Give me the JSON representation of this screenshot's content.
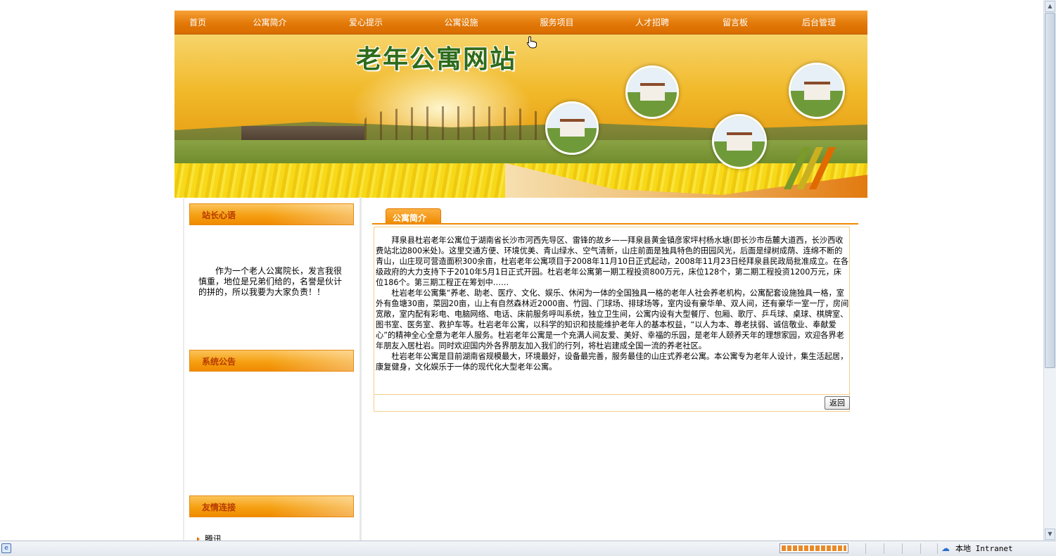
{
  "site": {
    "nav": [
      "首页",
      "公寓简介",
      "爱心提示",
      "公寓设施",
      "服务项目",
      "人才招聘",
      "留言板",
      "后台管理"
    ],
    "banner_title": "老年公寓网站"
  },
  "sidebar": {
    "director_header": "站长心语",
    "director_note": "作为一个老人公寓院长，发言我很慎重，地位是兄弟们给的，名誉是伙计的拼的，所以我要为大家负责！！",
    "announcement_header": "系统公告",
    "links_header": "友情连接",
    "links": [
      "腾讯"
    ]
  },
  "content": {
    "tab_label": "公寓简介",
    "paragraphs": [
      "拜泉县杜岩老年公寓位于湖南省长沙市河西先导区、雷锋的故乡——拜泉县黄金镇彦家坪村杨水塘(即长沙市岳麓大道西，长沙西收费站北边800米处)。这里交通方便、环境优美、青山绿水、空气清新，山庄前面是独具特色的田园风光，后面是绿树成荫、连绵不断的青山，山庄现可营造面积300余亩，杜岩老年公寓项目于2008年11月10日正式起动，2008年11月23日经拜泉县民政局批准成立。在各级政府的大力支持下于2010年5月1日正式开园。杜岩老年公寓第一期工程投资800万元，床位128个，第二期工程投资1200万元，床位186个。第三期工程正在筹划中……",
      "杜岩老年公寓集“养老、助老、医疗、文化、娱乐、休闲为一体的全国独具一格的老年人社会养老机构，公寓配套设施独具一格，室外有鱼塘30亩，菜园20亩，山上有自然森林近2000亩、竹园、门球场、排球场等，室内设有豪华单、双人间，还有豪华一室一厅，房间宽敞，室内配有彩电、电脑网络、电话、床前服务呼叫系统，独立卫生间，公寓内设有大型餐厅、包厢、歌厅、乒乓球、桌球、棋牌室、图书室、医务室、救护车等。杜岩老年公寓，以科学的知识和技能维护老年人的基本权益，“以人为本、尊老扶弱、诚信敬业、奉献爱心”的精神全心全意为老年人服务。杜岩老年公寓是一个充满人间友爱、美好、幸福的乐园，是老年人颐养天年的理想家园，欢迎各界老年朋友入居杜岩。同时欢迎国内外各界朋友加入我们的行列，将杜岩建成全国一流的养老社区。",
      "杜岩老年公寓是目前湖南省规模最大，环境最好，设备最完善，服务最佳的山庄式养老公寓。本公寓专为老年人设计，集生活起居，康复健身，文化娱乐于一体的现代化大型老年公寓。"
    ],
    "back_button": "返回"
  },
  "statusbar": {
    "zone": "本地 Intranet",
    "progress": 1.0
  },
  "colors": {
    "nav_orange": "#e27908",
    "header_text": "#b83a00",
    "accent": "#f08a00",
    "title_green": "#2e6b1b"
  }
}
